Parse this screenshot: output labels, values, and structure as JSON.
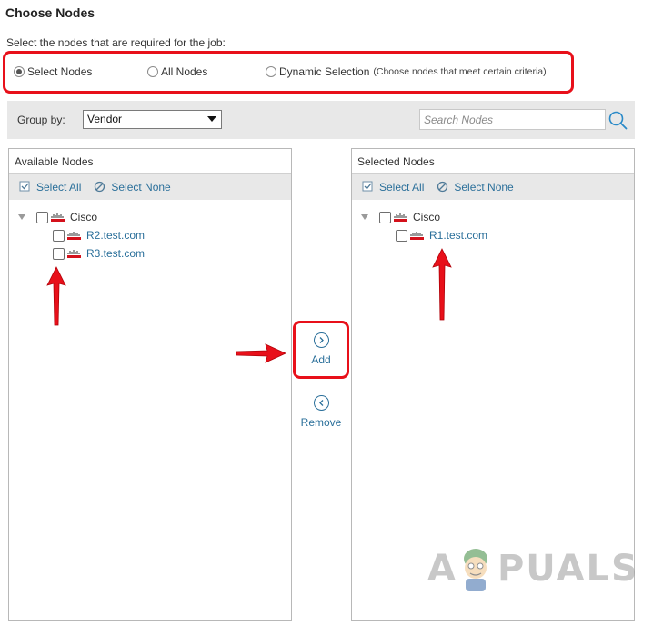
{
  "page": {
    "title": "Choose Nodes",
    "instruction": "Select the nodes that are required for the job:"
  },
  "radio": {
    "options": [
      {
        "label": "Select Nodes",
        "checked": true
      },
      {
        "label": "All Nodes",
        "checked": false
      },
      {
        "label": "Dynamic Selection",
        "checked": false,
        "hint": "(Choose nodes that meet certain criteria)"
      }
    ]
  },
  "toolbar": {
    "group_by_label": "Group by:",
    "group_by_value": "Vendor",
    "search_placeholder": "Search Nodes"
  },
  "available": {
    "title": "Available Nodes",
    "select_all": "Select All",
    "select_none": "Select None",
    "group": "Cisco",
    "nodes": [
      "R2.test.com",
      "R3.test.com"
    ]
  },
  "selected": {
    "title": "Selected Nodes",
    "select_all": "Select All",
    "select_none": "Select None",
    "group": "Cisco",
    "nodes": [
      "R1.test.com"
    ]
  },
  "actions": {
    "add": "Add",
    "remove": "Remove"
  },
  "watermark": {
    "text_a": "A",
    "text_rest": "PUALS"
  },
  "colors": {
    "highlight": "#e8101a",
    "link": "#2a6f9a",
    "toolbar_bg": "#e8e8e8"
  },
  "icons": {
    "vendor": "cisco-logo-icon",
    "select_all": "checkbox-check-icon",
    "select_none": "circle-slash-icon",
    "search": "search-icon",
    "add": "chevron-right-circle-icon",
    "remove": "chevron-left-circle-icon"
  }
}
